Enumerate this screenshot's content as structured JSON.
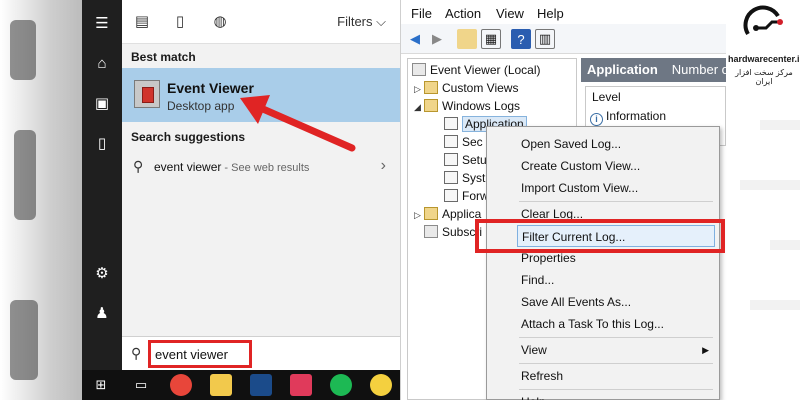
{
  "start_menu": {
    "filters_label": "Filters",
    "best_match_heading": "Best match",
    "best_match_title": "Event Viewer",
    "best_match_subtitle": "Desktop app",
    "suggestions_heading": "Search suggestions",
    "suggestion_text": "event viewer",
    "suggestion_web": " - See web results",
    "search_query": "event viewer"
  },
  "event_viewer": {
    "menu": [
      "File",
      "Action",
      "View",
      "Help"
    ],
    "tree": [
      {
        "label": "Event Viewer (Local)"
      },
      {
        "label": "Custom Views"
      },
      {
        "label": "Windows Logs"
      },
      {
        "label": "Application"
      },
      {
        "label": "Sec"
      },
      {
        "label": "Setu"
      },
      {
        "label": "Syst"
      },
      {
        "label": "Forw"
      },
      {
        "label": "Applica"
      },
      {
        "label": "Subscri"
      }
    ],
    "right_header_title": "Application",
    "right_header_sub": "Number of",
    "grid_column": "Level",
    "grid_row": "Information"
  },
  "context_menu": {
    "items": [
      "Open Saved Log...",
      "Create Custom View...",
      "Import Custom View...",
      "Clear Log...",
      "Filter Current Log...",
      "Properties",
      "Find...",
      "Save All Events As...",
      "Attach a Task To this Log...",
      "View",
      "Refresh",
      "Help"
    ]
  },
  "logo": {
    "name": "hardwarecenter.ir",
    "tagline": "مرکز سخت افزار ایران"
  },
  "colors": {
    "highlight": "#a9cde9",
    "red_annotation": "#e02424",
    "header_bg": "#6e7784"
  }
}
